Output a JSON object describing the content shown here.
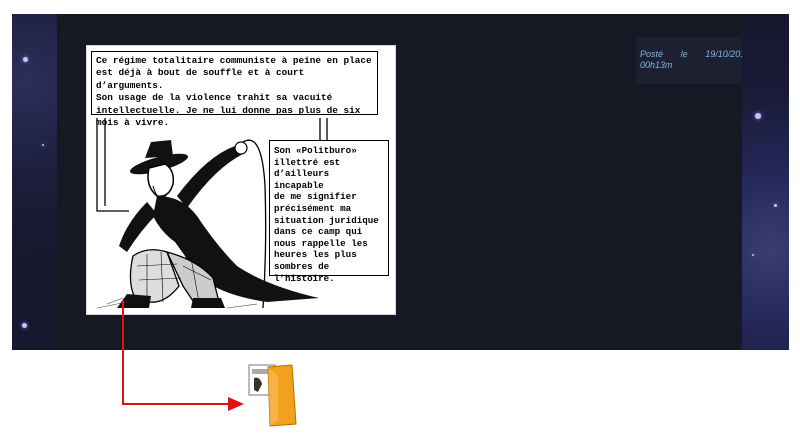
{
  "post": {
    "meta_prefix": "Posté",
    "meta_le": "le",
    "meta_date": "19/10/2019",
    "meta_a": "à",
    "meta_time": "00h13m"
  },
  "comic": {
    "bubble_top": "Ce régime totalitaire communiste à peine en place\nest déjà à bout de souffle et à court d’arguments.\nSon usage de la violence trahit sa vacuité\nintellectuelle. Je ne lui donne pas plus de six\nmois à vivre.",
    "bubble_right": "Son «Politburo»\nillettré est\nd’ailleurs incapable\nde me signifier\nprécisément ma\nsituation juridique\ndans ce camp qui\nnous rappelle les\nheures les plus\nsombres de\nl’histoire."
  },
  "colors": {
    "arrow": "#e01010",
    "icon_orange": "#f2a01e",
    "meta_text": "#7bb8e6"
  },
  "icons": {
    "file_icon": "document-image-icon"
  }
}
